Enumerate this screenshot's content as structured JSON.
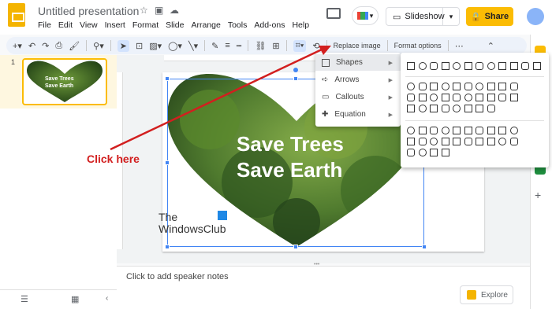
{
  "app": {
    "title": "Untitled presentation"
  },
  "menus": [
    "File",
    "Edit",
    "View",
    "Insert",
    "Format",
    "Slide",
    "Arrange",
    "Tools",
    "Add-ons",
    "Help"
  ],
  "header": {
    "slideshow_label": "Slideshow",
    "share_label": "Share"
  },
  "toolbar": {
    "replace_image_label": "Replace image",
    "format_options_label": "Format options"
  },
  "filmstrip": {
    "slide_number": "1"
  },
  "slide": {
    "headline_line1": "Save Trees",
    "headline_line2": "Save Earth"
  },
  "watermark": {
    "line1": "The",
    "line2": "WindowsClub"
  },
  "notes": {
    "placeholder": "Click to add speaker notes"
  },
  "explore": {
    "label": "Explore"
  },
  "mask_menu": {
    "items": [
      {
        "label": "Shapes",
        "icon": "square-icon"
      },
      {
        "label": "Arrows",
        "icon": "arrow-icon"
      },
      {
        "label": "Callouts",
        "icon": "callout-icon"
      },
      {
        "label": "Equation",
        "icon": "plus-icon"
      }
    ]
  },
  "annotation": {
    "label": "Click here",
    "color": "#d21f1f"
  },
  "colors": {
    "accent": "#fbbc04",
    "selection": "#4285f4",
    "foliage": "#3f6b2a"
  }
}
